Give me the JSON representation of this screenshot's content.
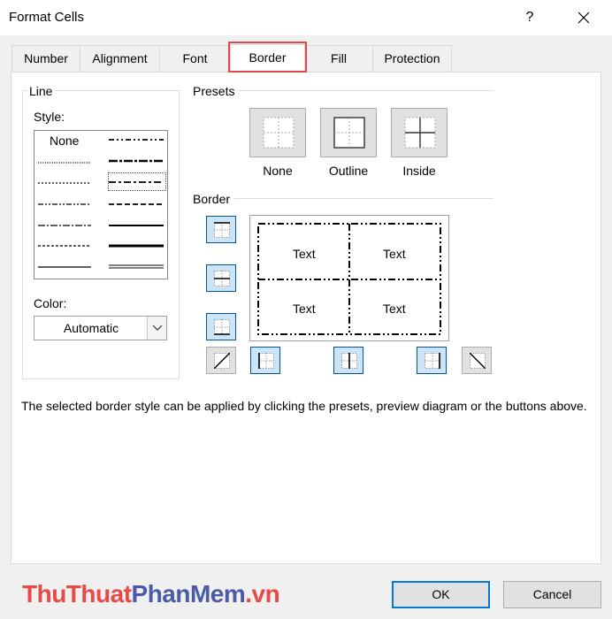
{
  "dialog": {
    "title": "Format Cells",
    "help_glyph": "?"
  },
  "tabs": [
    {
      "label": "Number"
    },
    {
      "label": "Alignment"
    },
    {
      "label": "Font"
    },
    {
      "label": "Border",
      "active": true
    },
    {
      "label": "Fill"
    },
    {
      "label": "Protection"
    }
  ],
  "line": {
    "group_label": "Line",
    "style_label": "Style:",
    "style_none": "None",
    "color_label": "Color:",
    "color_value": "Automatic"
  },
  "presets": {
    "group_label": "Presets",
    "items": [
      {
        "label": "None",
        "icon": "preset-none-icon"
      },
      {
        "label": "Outline",
        "icon": "preset-outline-icon"
      },
      {
        "label": "Inside",
        "icon": "preset-inside-icon"
      }
    ]
  },
  "border": {
    "group_label": "Border",
    "preview_cells": [
      "Text",
      "Text",
      "Text",
      "Text"
    ]
  },
  "hint": "The selected border style can be applied by clicking the presets, preview diagram or the buttons above.",
  "footer": {
    "ok_label": "OK",
    "cancel_label": "Cancel"
  },
  "watermark": {
    "part1": "ThuThuat",
    "part2": "PhanMem",
    "part3": ".vn"
  },
  "colors": {
    "tab_highlight": "#e2474b",
    "button_selected_bg": "#cce4f7",
    "button_selected_border": "#005499",
    "watermark_red": "#e84a48",
    "watermark_blue": "#4b5ba8"
  }
}
